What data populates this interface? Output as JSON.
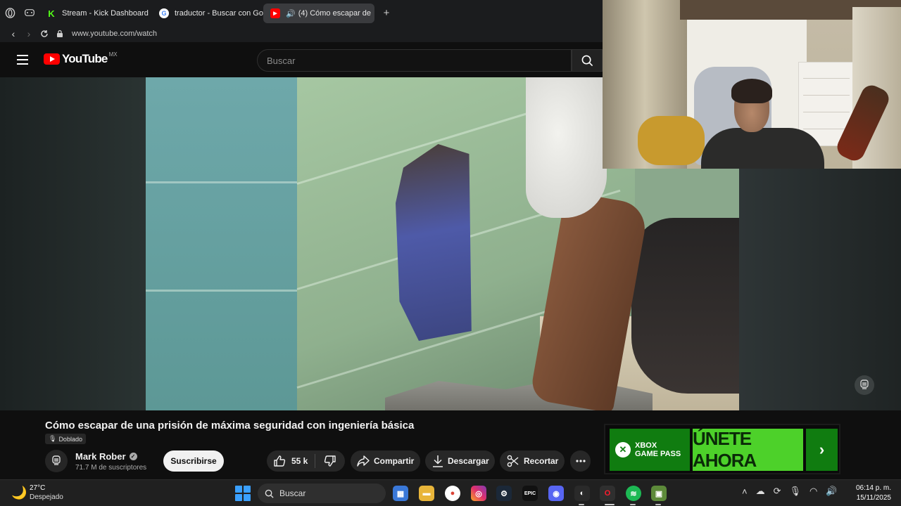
{
  "browser": {
    "tabs": [
      {
        "label": "Stream - Kick Dashboard",
        "favicon": "kick-icon"
      },
      {
        "label": "traductor - Buscar con Go",
        "favicon": "google-icon"
      },
      {
        "label": "(4) Cómo escapar de",
        "favicon": "youtube-icon",
        "active": true
      }
    ],
    "url": "www.youtube.com/watch"
  },
  "youtube": {
    "logo_text": "YouTube",
    "region": "MX",
    "search_placeholder": "Buscar"
  },
  "video": {
    "title": "Cómo escapar de una prisión de máxima seguridad con ingeniería básica",
    "badge": "Doblado",
    "channel": "Mark Rober",
    "subscribers": "71.7 M de suscriptores",
    "subscribe_label": "Suscribirse",
    "likes": "55 k",
    "share_label": "Compartir",
    "download_label": "Descargar",
    "clip_label": "Recortar"
  },
  "ad": {
    "logo_line1": "XBOX",
    "logo_line2": "GAME PASS",
    "cta": "ÚNETE AHORA",
    "arrow": "›"
  },
  "taskbar": {
    "weather_temp": "27°C",
    "weather_desc": "Despejado",
    "search_label": "Buscar",
    "time": "06:14 p. m.",
    "date": "15/11/2025"
  },
  "colors": {
    "youtube_red": "#ff0000",
    "xbox_green": "#107c10",
    "cta_green": "#4dd12a",
    "background": "#0f0f0f"
  }
}
